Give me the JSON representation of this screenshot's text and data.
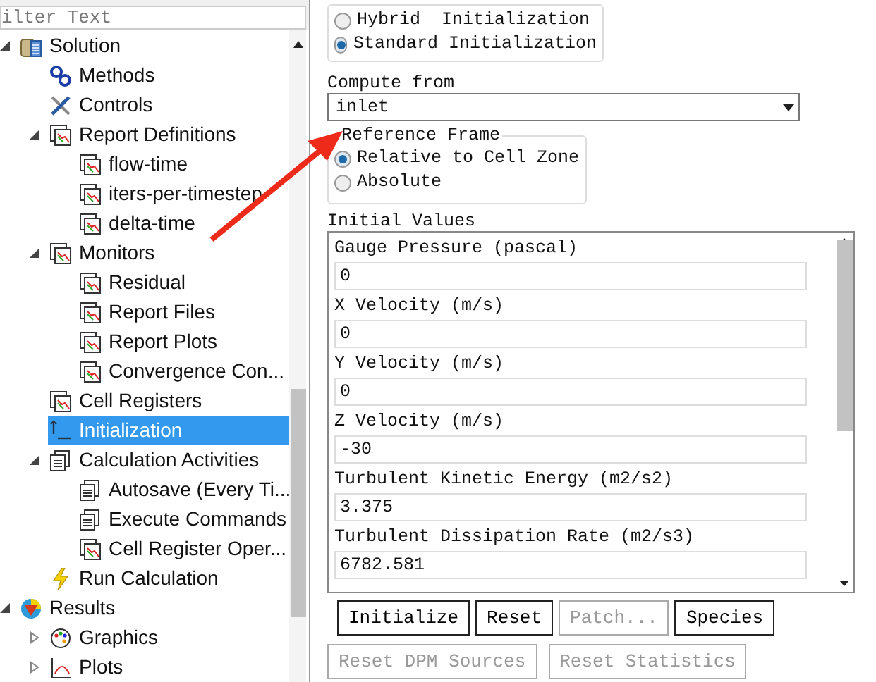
{
  "filter": {
    "placeholder": "ilter Text"
  },
  "tree": [
    {
      "label": "Solution",
      "kind": "database",
      "expanded": true,
      "selected": false,
      "children": [
        {
          "label": "Methods",
          "kind": "methods",
          "selected": false
        },
        {
          "label": "Controls",
          "kind": "controls",
          "selected": false
        },
        {
          "label": "Report Definitions",
          "kind": "report",
          "expanded": true,
          "selected": false,
          "children": [
            {
              "label": "flow-time",
              "kind": "report",
              "selected": false
            },
            {
              "label": "iters-per-timestep",
              "kind": "report",
              "selected": false
            },
            {
              "label": "delta-time",
              "kind": "report",
              "selected": false
            }
          ]
        },
        {
          "label": "Monitors",
          "kind": "report",
          "expanded": true,
          "selected": false,
          "children": [
            {
              "label": "Residual",
              "kind": "report",
              "selected": false
            },
            {
              "label": "Report Files",
              "kind": "report",
              "selected": false
            },
            {
              "label": "Report Plots",
              "kind": "report",
              "selected": false
            },
            {
              "label": "Convergence Con...",
              "kind": "report",
              "selected": false
            }
          ]
        },
        {
          "label": "Cell Registers",
          "kind": "report",
          "selected": false
        },
        {
          "label": "Initialization",
          "kind": "init",
          "selected": true
        },
        {
          "label": "Calculation Activities",
          "kind": "activity",
          "expanded": true,
          "selected": false,
          "children": [
            {
              "label": "Autosave (Every Ti...",
              "kind": "activity",
              "selected": false
            },
            {
              "label": "Execute Commands",
              "kind": "activity",
              "selected": false
            },
            {
              "label": "Cell Register Oper...",
              "kind": "report",
              "selected": false
            }
          ]
        },
        {
          "label": "Run Calculation",
          "kind": "run",
          "selected": false
        }
      ]
    },
    {
      "label": "Results",
      "kind": "results",
      "expanded": true,
      "selected": false,
      "children": [
        {
          "label": "Graphics",
          "kind": "graphics",
          "expanded": false,
          "selected": false
        },
        {
          "label": "Plots",
          "kind": "plots",
          "expanded": false,
          "selected": false
        }
      ]
    }
  ],
  "method": [
    {
      "label": "Hybrid  Initialization",
      "selected": false
    },
    {
      "label": "Standard Initialization",
      "selected": true
    }
  ],
  "compute_from": {
    "label": "Compute from",
    "value": "inlet"
  },
  "reference_frame": {
    "title": "Reference Frame",
    "options": [
      {
        "label": "Relative to Cell Zone",
        "selected": true
      },
      {
        "label": "Absolute",
        "selected": false
      }
    ]
  },
  "initial_values": {
    "title": "Initial Values",
    "fields": [
      {
        "label": "Gauge Pressure (pascal)",
        "value": "0"
      },
      {
        "label": "X Velocity (m/s)",
        "value": "0"
      },
      {
        "label": "Y Velocity (m/s)",
        "value": "0"
      },
      {
        "label": "Z Velocity (m/s)",
        "value": "-30"
      },
      {
        "label": "Turbulent Kinetic Energy (m2/s2)",
        "value": "3.375"
      },
      {
        "label": "Turbulent Dissipation Rate (m2/s3)",
        "value": "6782.581"
      }
    ]
  },
  "buttons": [
    {
      "label": "Initialize",
      "disabled": false
    },
    {
      "label": "Reset",
      "disabled": false
    },
    {
      "label": "Patch...",
      "disabled": true
    },
    {
      "label": "Species",
      "disabled": false
    }
  ],
  "bottom_buttons": [
    {
      "label": "Reset DPM Sources",
      "disabled": true
    },
    {
      "label": "Reset Statistics",
      "disabled": true
    }
  ]
}
